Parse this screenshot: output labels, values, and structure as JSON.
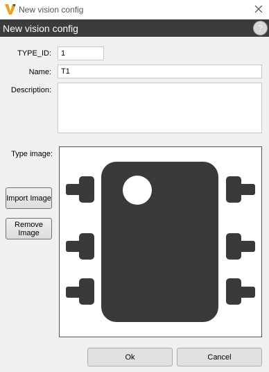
{
  "window": {
    "title": "New vision config",
    "accent_color": "#e8a317"
  },
  "header": {
    "title": "New vision config",
    "help_label": "?"
  },
  "form": {
    "type_id_label": "TYPE_ID:",
    "type_id_value": "1",
    "name_label": "Name:",
    "name_value": "T1",
    "description_label": "Description:",
    "description_value": "",
    "type_image_label": "Type image:"
  },
  "buttons": {
    "import_image": "Import Image",
    "remove_image": "Remove Image",
    "ok": "Ok",
    "cancel": "Cancel"
  },
  "image": {
    "icon": "ic-chip-icon",
    "color": "#3a3a3a"
  }
}
